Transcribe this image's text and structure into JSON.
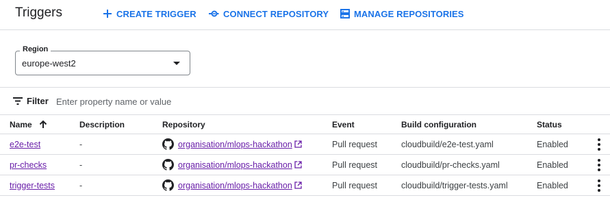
{
  "header": {
    "title": "Triggers",
    "actions": {
      "create": "CREATE TRIGGER",
      "connect": "CONNECT REPOSITORY",
      "manage": "MANAGE REPOSITORIES"
    }
  },
  "region": {
    "label": "Region",
    "value": "europe-west2"
  },
  "filter": {
    "label": "Filter",
    "placeholder": "Enter property name or value"
  },
  "table": {
    "columns": {
      "name": "Name",
      "description": "Description",
      "repository": "Repository",
      "event": "Event",
      "build": "Build configuration",
      "status": "Status"
    },
    "sort": {
      "column": "Name",
      "direction": "ascending"
    },
    "rows": [
      {
        "name": "e2e-test",
        "description": "-",
        "repository": "organisation/mlops-hackathon",
        "event": "Pull request",
        "build": "cloudbuild/e2e-test.yaml",
        "status": "Enabled"
      },
      {
        "name": "pr-checks",
        "description": "-",
        "repository": "organisation/mlops-hackathon",
        "event": "Pull request",
        "build": "cloudbuild/pr-checks.yaml",
        "status": "Enabled"
      },
      {
        "name": "trigger-tests",
        "description": "-",
        "repository": "organisation/mlops-hackathon",
        "event": "Pull request",
        "build": "cloudbuild/trigger-tests.yaml",
        "status": "Enabled"
      }
    ]
  },
  "colors": {
    "accent": "#1a73e8",
    "link_visited": "#681da8",
    "divider": "#dadce0"
  },
  "icons": [
    "plus-icon",
    "connect-icon",
    "manage-repositories-icon",
    "filter-icon",
    "sort-arrow-up-icon",
    "github-icon",
    "external-link-icon",
    "more-vert-icon",
    "dropdown-caret-icon"
  ]
}
